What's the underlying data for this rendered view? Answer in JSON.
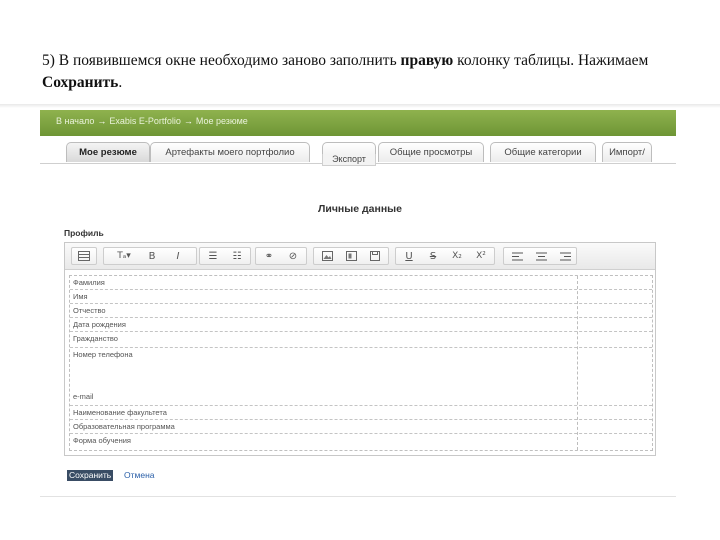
{
  "caption": {
    "part1": "5) В появившемся окне необходимо заново заполнить ",
    "bold1": "правую",
    "part2": " колонку таблицы. Нажимаем ",
    "bold2": "Сохранить",
    "part3": "."
  },
  "breadcrumb": {
    "items": [
      "В начало",
      "Exabis E-Portfolio",
      "Мое резюме"
    ],
    "separator": "→"
  },
  "tabs": [
    {
      "label": "Мое резюме",
      "active": true
    },
    {
      "label": "Артефакты моего портфолио",
      "active": false
    },
    {
      "label": "",
      "active": false
    },
    {
      "label": "Общие просмотры",
      "active": false
    },
    {
      "label": "Общие категории",
      "active": false
    },
    {
      "label": "Импорт/",
      "active": false
    }
  ],
  "tab_sub_label": "Экспорт",
  "section_title": "Личные данные",
  "profile_label": "Профиль",
  "table_rows": [
    "Фамилия",
    "Имя",
    "Отчество",
    "Дата рождения",
    "Гражданство",
    "Номер телефона",
    "e-mail",
    "Наименование факультета",
    "Образовательная программа",
    "Форма обучения"
  ],
  "actions": {
    "save_label": "Сохранить",
    "cancel_label": "Отмена"
  },
  "colors": {
    "green_band": "#7aa03f",
    "save_bg": "#394c64",
    "link": "#2a5fa8"
  },
  "toolbar_icons": [
    "table-icon",
    "font-size-icon",
    "bold-icon",
    "italic-icon",
    "bullet-list-icon",
    "numbered-list-icon",
    "link-icon",
    "unlink-icon",
    "image-icon",
    "media-icon",
    "save-icon",
    "underline-icon",
    "strikethrough-icon",
    "subscript-icon",
    "superscript-icon",
    "align-left-icon",
    "align-center-icon",
    "align-right-icon"
  ]
}
